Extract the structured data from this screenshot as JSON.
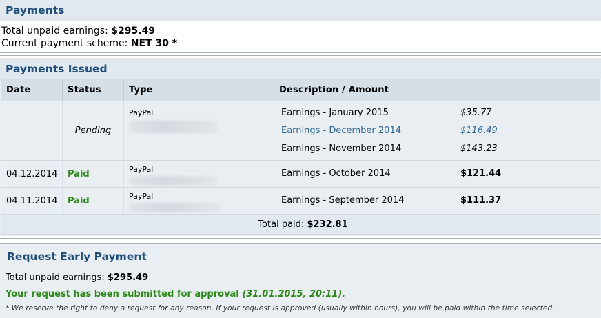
{
  "payments": {
    "title": "Payments",
    "unpaid_label": "Total unpaid earnings:",
    "unpaid_value": "$295.49",
    "scheme_label": "Current payment scheme:",
    "scheme_value": "NET 30 *"
  },
  "issued": {
    "title": "Payments Issued",
    "columns": [
      "Date",
      "Status",
      "Type",
      "Description / Amount"
    ],
    "rows": [
      {
        "date": "",
        "status": "Pending",
        "type": "PayPal",
        "items": [
          {
            "desc": "Earnings - January 2015",
            "amount": "$35.77"
          },
          {
            "desc": "Earnings - December 2014",
            "amount": "$116.49"
          },
          {
            "desc": "Earnings - November 2014",
            "amount": "$143.23"
          }
        ]
      },
      {
        "date": "04.12.2014",
        "status": "Paid",
        "type": "PayPal",
        "items": [
          {
            "desc": "Earnings - October 2014",
            "amount": "$121.44"
          }
        ]
      },
      {
        "date": "04.11.2014",
        "status": "Paid",
        "type": "PayPal",
        "items": [
          {
            "desc": "Earnings - September 2014",
            "amount": "$111.37"
          }
        ]
      }
    ],
    "total_label": "Total paid:",
    "total_value": "$232.81"
  },
  "early": {
    "title": "Request Early Payment",
    "unpaid_label": "Total unpaid earnings:",
    "unpaid_value": "$295.49",
    "submitted_text": "Your request has been submitted for approval",
    "submitted_time": "(31.01.2015, 20:11).",
    "note": "* We reserve the right to deny a request for any reason. If your request is approved (usually within hours), you will be paid within the time selected."
  },
  "colors": {
    "header_bg": "#e1e8ef",
    "header_text": "#1f4f7a",
    "paid_green": "#2b8a16",
    "highlight_blue": "#2e6796"
  }
}
